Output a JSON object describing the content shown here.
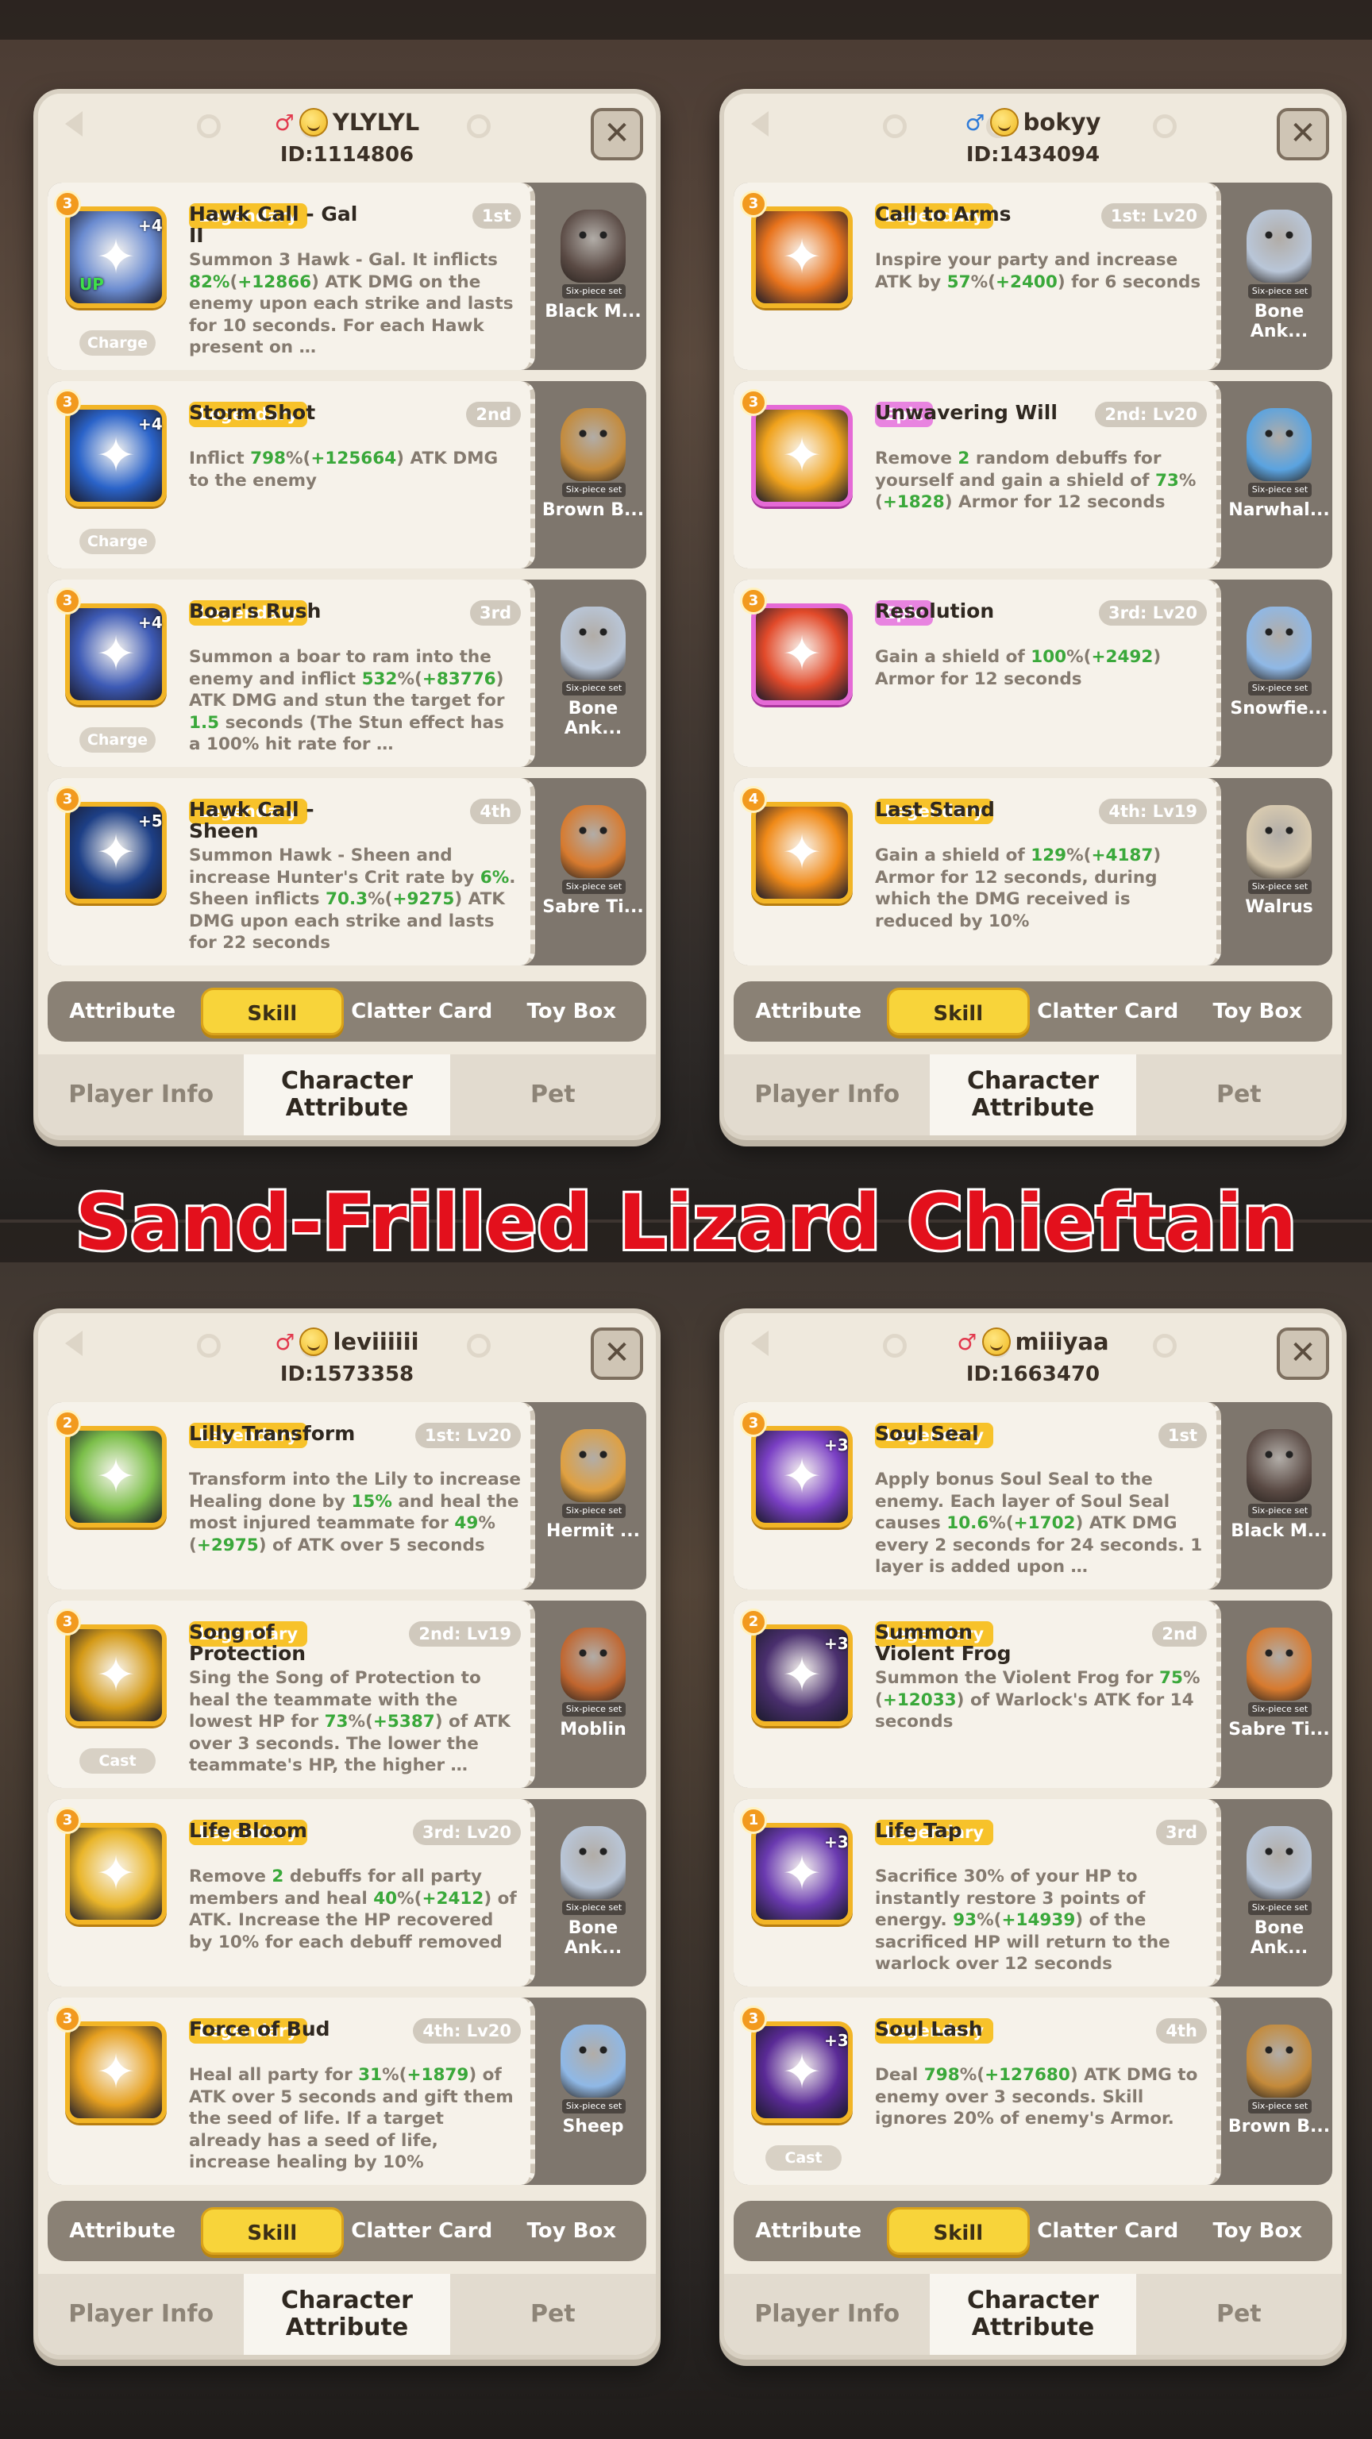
{
  "banner_title": "Sand-Frilled Lizard Chieftain",
  "panels": [
    {
      "player_name": "YLYLYL",
      "gender": "♂",
      "gender_class": "female",
      "player_id": "ID:1114806",
      "skills": [
        {
          "level": "3",
          "plus": "+4",
          "up": "UP",
          "rarity": "Legendary",
          "name": "Hawk Call - Gal II",
          "slot": "1st",
          "desc": [
            {
              "t": "Summon 3 Hawk - Gal. It inflicts "
            },
            {
              "t": "82%",
              "g": true
            },
            {
              "t": "("
            },
            {
              "t": "+12866",
              "g": true
            },
            {
              "t": ") ATK DMG on the enemy upon each strike and lasts for 10 seconds. For each Hawk present on …"
            }
          ],
          "tag": "Charge",
          "pet": "Black M...",
          "set": "Six-piece set",
          "icon_color": "#6a8bd0",
          "pet_color": "#5a4a44"
        },
        {
          "level": "3",
          "plus": "+4",
          "rarity": "Legendary",
          "name": "Storm Shot",
          "slot": "2nd",
          "desc": [
            {
              "t": "Inflict "
            },
            {
              "t": "798",
              "g": true
            },
            {
              "t": "%("
            },
            {
              "t": "+125664",
              "g": true
            },
            {
              "t": ") ATK DMG to the enemy"
            }
          ],
          "tag": "Charge",
          "pet": "Brown B...",
          "set": "Six-piece set",
          "icon_color": "#2a63c9",
          "pet_color": "#c48a3a"
        },
        {
          "level": "3",
          "plus": "+4",
          "rarity": "Legendary",
          "name": "Boar's Rush",
          "slot": "3rd",
          "desc": [
            {
              "t": "Summon a boar to ram into the enemy and inflict "
            },
            {
              "t": "532",
              "g": true
            },
            {
              "t": "%("
            },
            {
              "t": "+83776",
              "g": true
            },
            {
              "t": ") ATK DMG and stun the target for "
            },
            {
              "t": "1.5",
              "g": true
            },
            {
              "t": " seconds (The Stun effect has a 100% hit rate for …"
            }
          ],
          "tag": "Charge",
          "pet": "Bone Ank...",
          "set": "Six-piece set",
          "icon_color": "#3d5ab5",
          "pet_color": "#b9c6d8"
        },
        {
          "level": "3",
          "plus": "+5",
          "rarity": "Legendary",
          "name": "Hawk Call - Sheen",
          "slot": "4th",
          "desc": [
            {
              "t": "Summon Hawk - Sheen and increase Hunter's Crit rate by "
            },
            {
              "t": "6%",
              "g": true
            },
            {
              "t": ". Sheen inflicts "
            },
            {
              "t": "70.3",
              "g": true
            },
            {
              "t": "%("
            },
            {
              "t": "+9275",
              "g": true
            },
            {
              "t": ") ATK DMG upon each strike and lasts for 22 seconds"
            }
          ],
          "pet": "Sabre Ti...",
          "set": "Six-piece set",
          "icon_color": "#1d3f86",
          "pet_color": "#d77a2e"
        }
      ]
    },
    {
      "player_name": "bokyy",
      "gender": "♂",
      "gender_class": "male",
      "player_id": "ID:1434094",
      "skills": [
        {
          "level": "3",
          "rarity": "Legendary",
          "name": "Call to Arms",
          "slot": "1st: Lv20",
          "desc": [
            {
              "t": "Inspire your party and increase ATK by "
            },
            {
              "t": "57",
              "g": true
            },
            {
              "t": "%("
            },
            {
              "t": "+2400",
              "g": true
            },
            {
              "t": ") for 6 seconds"
            }
          ],
          "pet": "Bone Ank...",
          "set": "Six-piece set",
          "icon_color": "#e8731c",
          "pet_color": "#b9c6d8"
        },
        {
          "level": "3",
          "rarity": "Epic",
          "epic": true,
          "name": "Unwavering Will",
          "slot": "2nd: Lv20",
          "desc": [
            {
              "t": "Remove "
            },
            {
              "t": "2",
              "g": true
            },
            {
              "t": " random debuffs for yourself and gain a shield of "
            },
            {
              "t": "73",
              "g": true
            },
            {
              "t": "%("
            },
            {
              "t": "+1828",
              "g": true
            },
            {
              "t": ") Armor for 12 seconds"
            }
          ],
          "pet": "Narwhal...",
          "set": "Six-piece set",
          "icon_color": "#f0a21c",
          "pet_color": "#5aa3e0"
        },
        {
          "level": "3",
          "rarity": "Epic",
          "epic": true,
          "name": "Resolution",
          "slot": "3rd: Lv20",
          "desc": [
            {
              "t": "Gain a shield of "
            },
            {
              "t": "100",
              "g": true
            },
            {
              "t": "%("
            },
            {
              "t": "+2492",
              "g": true
            },
            {
              "t": ") Armor for 12 seconds"
            }
          ],
          "pet": "Snowfie...",
          "set": "Six-piece set",
          "icon_color": "#e24a2a",
          "pet_color": "#8fb8e6"
        },
        {
          "level": "4",
          "rarity": "Legendary",
          "name": "Last Stand",
          "slot": "4th: Lv19",
          "desc": [
            {
              "t": "Gain a shield of "
            },
            {
              "t": "129",
              "g": true
            },
            {
              "t": "%("
            },
            {
              "t": "+4187",
              "g": true
            },
            {
              "t": ") Armor for 12 seconds, during which the DMG received is reduced by 10%"
            }
          ],
          "pet": "Walrus",
          "set": "Six-piece set",
          "icon_color": "#f08a18",
          "pet_color": "#d9cbb0"
        }
      ]
    },
    {
      "player_name": "leviiiiii",
      "gender": "♂",
      "gender_class": "female",
      "player_id": "ID:1573358",
      "skills": [
        {
          "level": "2",
          "rarity": "Legendary",
          "name": "Lilly Transform",
          "slot": "1st: Lv20",
          "desc": [
            {
              "t": "Transform into the Lily to increase Healing done by "
            },
            {
              "t": "15%",
              "g": true
            },
            {
              "t": " and heal the most injured teammate for "
            },
            {
              "t": "49",
              "g": true
            },
            {
              "t": "%("
            },
            {
              "t": "+2975",
              "g": true
            },
            {
              "t": ") of ATK over 5 seconds"
            }
          ],
          "pet": "Hermit ...",
          "set": "Six-piece set",
          "icon_color": "#7cbf4a",
          "pet_color": "#e0a040"
        },
        {
          "level": "3",
          "rarity": "Legendary",
          "name": "Song of Protection",
          "slot": "2nd: Lv19",
          "desc": [
            {
              "t": "Sing the Song of Protection to heal the teammate with the lowest HP for "
            },
            {
              "t": "73",
              "g": true
            },
            {
              "t": "%("
            },
            {
              "t": "+5387",
              "g": true
            },
            {
              "t": ") of ATK over 3 seconds. The lower the teammate's HP, the higher …"
            }
          ],
          "tag": "Cast",
          "pet": "Moblin",
          "set": "Six-piece set",
          "icon_color": "#d49a18",
          "pet_color": "#c0652e"
        },
        {
          "level": "3",
          "rarity": "Legendary",
          "name": "Life Bloom",
          "slot": "3rd: Lv20",
          "desc": [
            {
              "t": "Remove "
            },
            {
              "t": "2",
              "g": true
            },
            {
              "t": " debuffs for all party members and heal "
            },
            {
              "t": "40",
              "g": true
            },
            {
              "t": "%("
            },
            {
              "t": "+2412",
              "g": true
            },
            {
              "t": ") of ATK. Increase the HP recovered by 10% for each debuff removed"
            }
          ],
          "pet": "Bone Ank...",
          "set": "Six-piece set",
          "icon_color": "#e9b52a",
          "pet_color": "#b9c6d8"
        },
        {
          "level": "3",
          "rarity": "Legendary",
          "name": "Force of Bud",
          "slot": "4th: Lv20",
          "desc": [
            {
              "t": "Heal all party for "
            },
            {
              "t": "31",
              "g": true
            },
            {
              "t": "%("
            },
            {
              "t": "+1879",
              "g": true
            },
            {
              "t": ") of ATK over 5 seconds and gift them the seed of life. If a target already has a seed of life, increase healing by 10%"
            }
          ],
          "pet": "Sheep",
          "set": "Six-piece set",
          "icon_color": "#e6a020",
          "pet_color": "#8fb8e6"
        }
      ]
    },
    {
      "player_name": "miiiyaa",
      "gender": "♂",
      "gender_class": "female",
      "player_id": "ID:1663470",
      "skills": [
        {
          "level": "3",
          "plus": "+3",
          "rarity": "Legendary",
          "name": "Soul Seal",
          "slot": "1st",
          "desc": [
            {
              "t": "Apply bonus Soul Seal to the enemy. Each layer of Soul Seal causes "
            },
            {
              "t": "10.6",
              "g": true
            },
            {
              "t": "%("
            },
            {
              "t": "+1702",
              "g": true
            },
            {
              "t": ") ATK DMG every 2 seconds for 24 seconds. 1 layer is added upon …"
            }
          ],
          "pet": "Black M...",
          "set": "Six-piece set",
          "icon_color": "#7a3fc4",
          "pet_color": "#5a4a44"
        },
        {
          "level": "2",
          "plus": "+3",
          "rarity": "Legendary",
          "name": "Summon Violent Frog",
          "slot": "2nd",
          "desc": [
            {
              "t": "Summon the Violent Frog for "
            },
            {
              "t": "75",
              "g": true
            },
            {
              "t": "%("
            },
            {
              "t": "+12033",
              "g": true
            },
            {
              "t": ") of Warlock's ATK for 14 seconds"
            }
          ],
          "pet": "Sabre Ti...",
          "set": "Six-piece set",
          "icon_color": "#4a2f6e",
          "pet_color": "#d77a2e"
        },
        {
          "level": "1",
          "plus": "+3",
          "rarity": "Legendary",
          "name": "Life Tap",
          "slot": "3rd",
          "desc": [
            {
              "t": "Sacrifice 30% of your HP to instantly restore 3 points of energy. "
            },
            {
              "t": "93",
              "g": true
            },
            {
              "t": "%("
            },
            {
              "t": "+14939",
              "g": true
            },
            {
              "t": ") of the sacrificed HP will return to the warlock over 12 seconds"
            }
          ],
          "pet": "Bone Ank...",
          "set": "Six-piece set",
          "icon_color": "#6a3ab0",
          "pet_color": "#b9c6d8"
        },
        {
          "level": "3",
          "plus": "+3",
          "rarity": "Legendary",
          "name": "Soul Lash",
          "slot": "4th",
          "desc": [
            {
              "t": "Deal "
            },
            {
              "t": "798",
              "g": true
            },
            {
              "t": "%("
            },
            {
              "t": "+127680",
              "g": true
            },
            {
              "t": ") ATK DMG to enemy over 3 seconds. Skill ignores 20% of enemy's Armor."
            }
          ],
          "tag": "Cast",
          "pet": "Brown B...",
          "set": "Six-piece set",
          "icon_color": "#5a2a96",
          "pet_color": "#c48a3a"
        }
      ]
    }
  ],
  "subtabs": [
    "Attribute",
    "Skill",
    "Clatter Card",
    "Toy Box"
  ],
  "active_subtab": "Skill",
  "bottomtabs": [
    "Player Info",
    "Character Attribute",
    "Pet"
  ],
  "active_bottomtab": "Character Attribute",
  "colors": {
    "legendary": "#f7c22a",
    "epic": "#e884e0",
    "highlight_green": "#3aa83a",
    "banner_red": "#e3101c"
  }
}
